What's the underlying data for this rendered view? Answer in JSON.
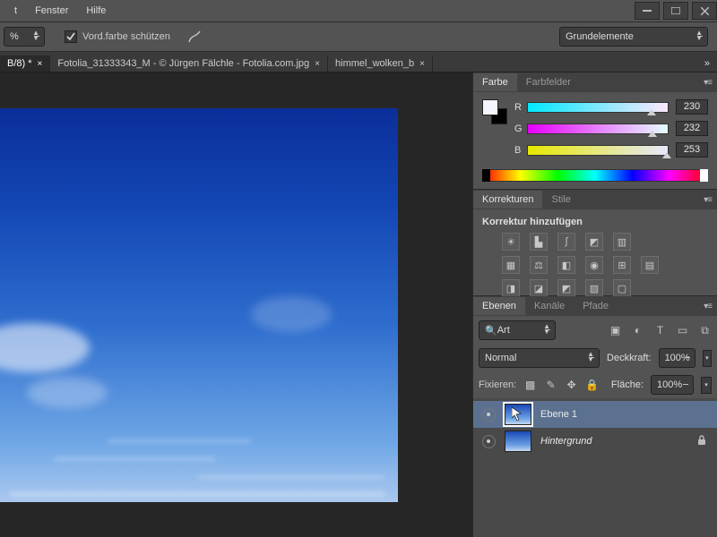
{
  "menu": {
    "items": [
      "t",
      "Fenster",
      "Hilfe"
    ]
  },
  "options": {
    "protect_fg_label": "Vord.farbe schützen",
    "workspace": "Grundelemente"
  },
  "tabs": {
    "items": [
      {
        "label": "B/8) *",
        "active": true
      },
      {
        "label": "Fotolia_31333343_M - © Jürgen Fälchle - Fotolia.com.jpg",
        "active": false
      },
      {
        "label": "himmel_wolken_b",
        "active": false
      }
    ],
    "overflow": "»"
  },
  "color_panel": {
    "tabs": [
      "Farbe",
      "Farbfelder"
    ],
    "channels": [
      {
        "label": "R",
        "value": "230",
        "gradient": "linear-gradient(to right,#00e8fd,#ffe8fd)"
      },
      {
        "label": "G",
        "value": "232",
        "gradient": "linear-gradient(to right,#e600fd,#e6fffd)"
      },
      {
        "label": "B",
        "value": "253",
        "gradient": "linear-gradient(to right,#e6e800,#e6e8ff)"
      }
    ]
  },
  "adjust_panel": {
    "tabs": [
      "Korrekturen",
      "Stile"
    ],
    "heading": "Korrektur hinzufügen"
  },
  "layers_panel": {
    "tabs": [
      "Ebenen",
      "Kanäle",
      "Pfade"
    ],
    "kind_label": "Art",
    "blend": "Normal",
    "opacity_label": "Deckkraft:",
    "opacity_value": "100%",
    "fill_label": "Fläche:",
    "fill_value": "100%",
    "fix_label": "Fixieren:",
    "layers": [
      {
        "name": "Ebene 1",
        "selected": true,
        "locked": false
      },
      {
        "name": "Hintergrund",
        "selected": false,
        "locked": true,
        "bg": true
      }
    ]
  }
}
